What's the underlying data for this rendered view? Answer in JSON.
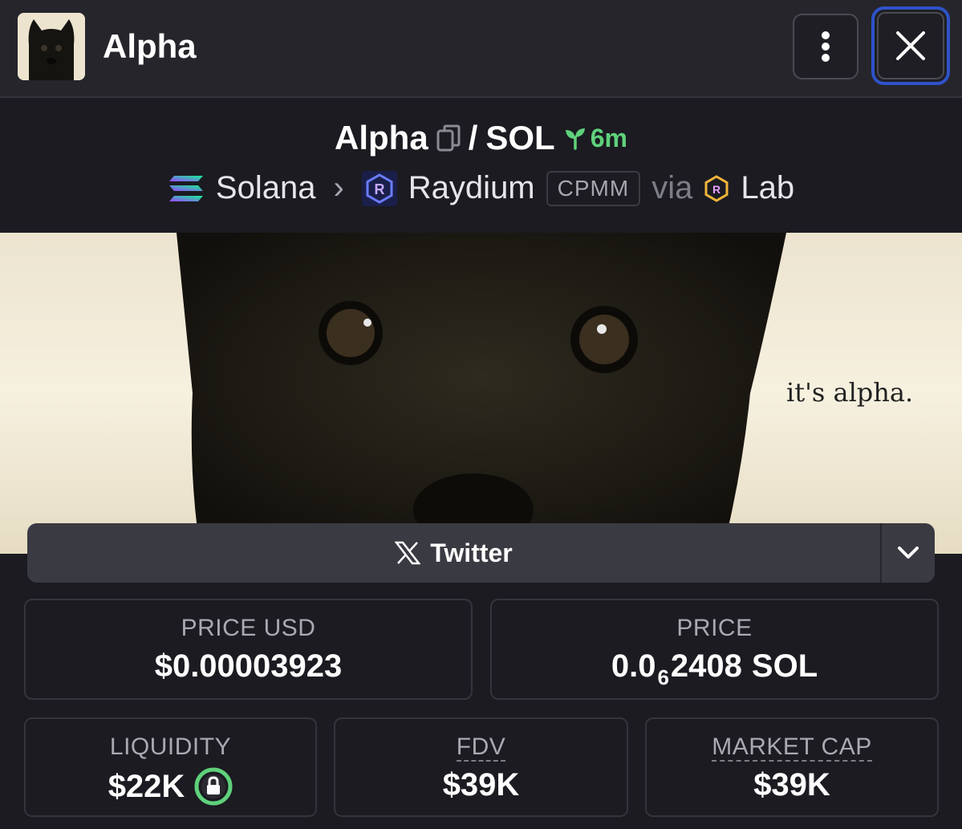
{
  "header": {
    "title": "Alpha",
    "more_icon": "kebab-vertical-icon",
    "close_icon": "close-icon"
  },
  "pair": {
    "base": "Alpha",
    "copy_icon": "copy-icon",
    "separator": "/",
    "quote": "SOL",
    "age_icon": "sprout-icon",
    "age": "6m",
    "chain": "Solana",
    "chevron": "›",
    "dex": "Raydium",
    "pool_type": "CPMM",
    "via": "via",
    "launchpad": "Lab"
  },
  "banner": {
    "caption": "it's alpha."
  },
  "social": {
    "label": "Twitter",
    "icon": "x-logo-icon",
    "dropdown_icon": "chevron-down-icon"
  },
  "stats": {
    "price_usd": {
      "label": "PRICE USD",
      "value": "$0.00003923"
    },
    "price": {
      "label": "PRICE",
      "prefix": "0.0",
      "zeros": "6",
      "digits": "2408",
      "unit": "SOL"
    },
    "liquidity": {
      "label": "LIQUIDITY",
      "value": "$22K",
      "icon": "lock-icon"
    },
    "fdv": {
      "label": "FDV",
      "value": "$39K"
    },
    "market_cap": {
      "label": "MARKET CAP",
      "value": "$39K"
    }
  },
  "colors": {
    "accent_green": "#5fd17b",
    "focus_blue": "#2f52c9",
    "background": "#1b1b21"
  }
}
